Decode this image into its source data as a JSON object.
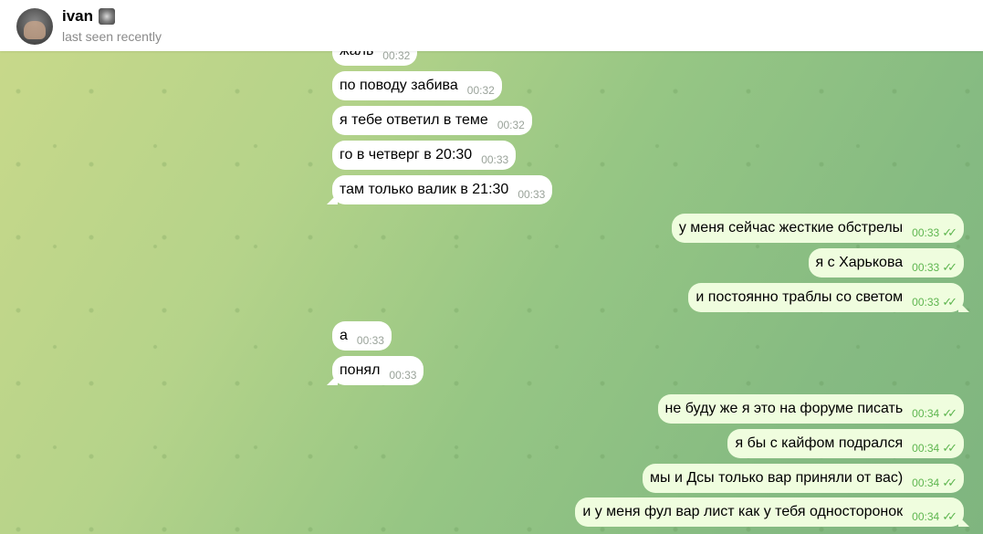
{
  "header": {
    "name": "ivan",
    "status": "last seen recently"
  },
  "messages": {
    "in": [
      {
        "text": "жаль",
        "time": "00:32"
      },
      {
        "text": "по поводу забива",
        "time": "00:32"
      },
      {
        "text": "я тебе ответил в теме",
        "time": "00:32"
      },
      {
        "text": "го в четверг в 20:30",
        "time": "00:33"
      },
      {
        "text": "там только валик в 21:30",
        "time": "00:33"
      },
      {
        "text": "а",
        "time": "00:33"
      },
      {
        "text": "понял",
        "time": "00:33"
      }
    ],
    "out": [
      {
        "text": "у меня сейчас жесткие обстрелы",
        "time": "00:33"
      },
      {
        "text": "я с Харькова",
        "time": "00:33"
      },
      {
        "text": "и постоянно траблы со светом",
        "time": "00:33"
      },
      {
        "text": "не буду же я это на форуме писать",
        "time": "00:34"
      },
      {
        "text": "я бы с кайфом подрался",
        "time": "00:34"
      },
      {
        "text": "мы и Дсы только вар приняли от вас)",
        "time": "00:34"
      },
      {
        "text": "и у меня фул вар лист как у тебя односторонок",
        "time": "00:34"
      }
    ]
  },
  "read_checks": "✓✓",
  "colors": {
    "incoming_bubble": "#ffffff",
    "outgoing_bubble": "#effdde",
    "outgoing_time": "#5fb650"
  }
}
